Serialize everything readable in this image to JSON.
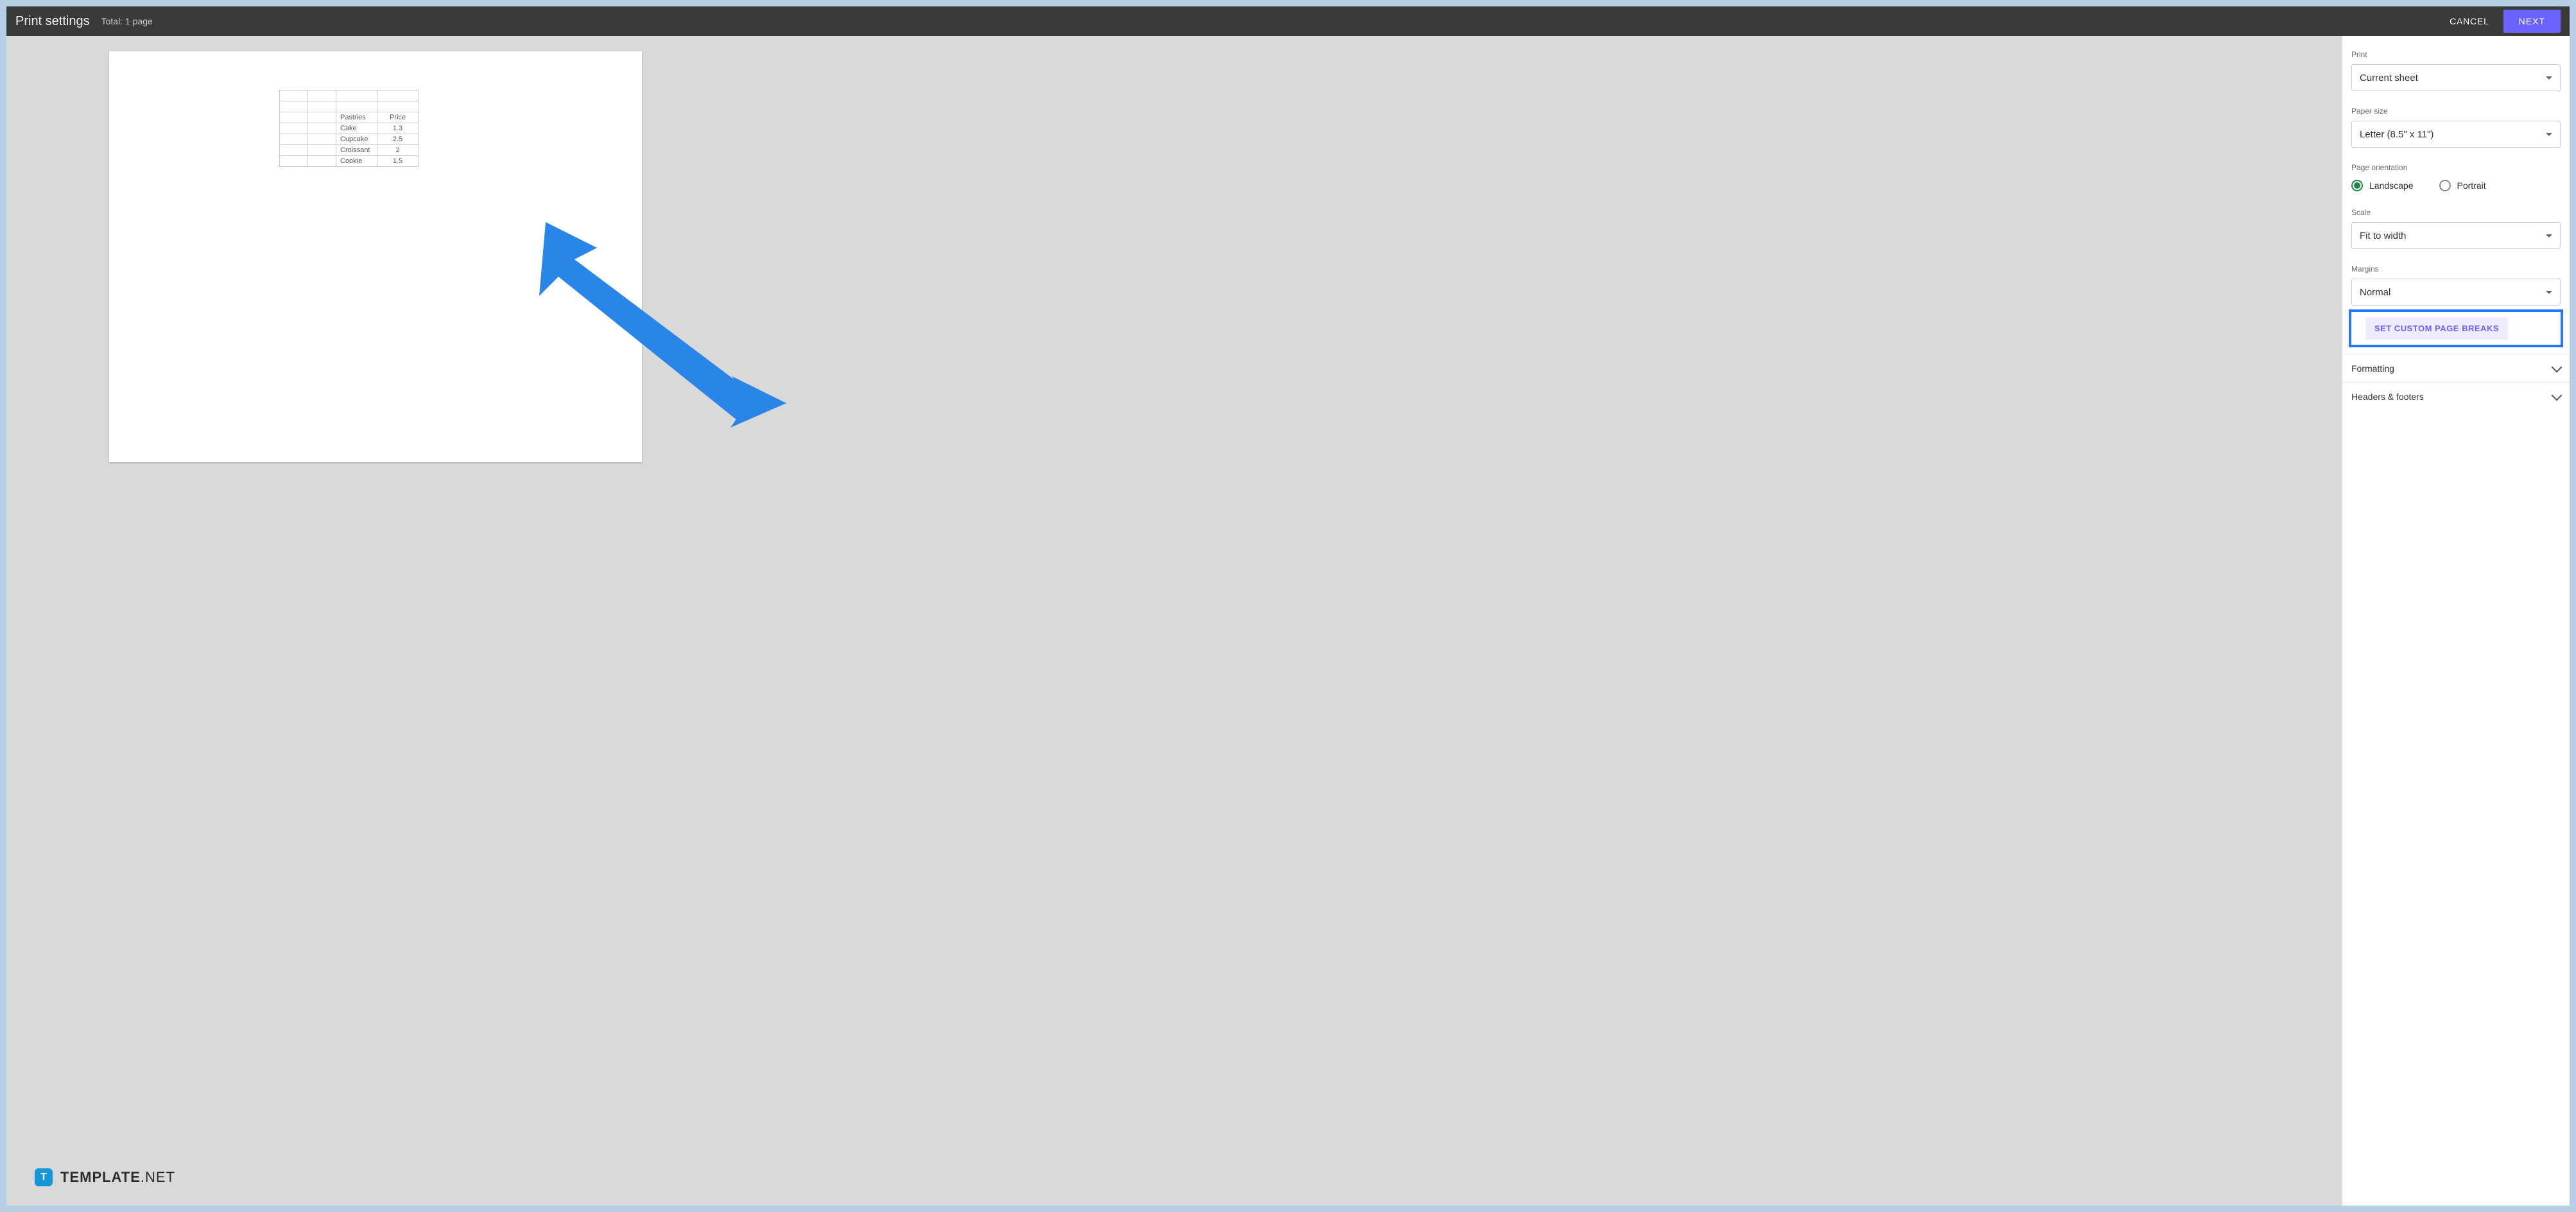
{
  "topbar": {
    "title": "Print settings",
    "total": "Total: 1 page",
    "cancel": "CANCEL",
    "next": "NEXT"
  },
  "preview_table": {
    "headers": {
      "col1": "Pastries",
      "col2": "Price"
    },
    "rows": [
      {
        "name": "Cake",
        "price": "1.3"
      },
      {
        "name": "Cupcake",
        "price": "2.5"
      },
      {
        "name": "Croissant",
        "price": "2"
      },
      {
        "name": "Cookie",
        "price": "1.5"
      }
    ]
  },
  "sidebar": {
    "print": {
      "label": "Print",
      "value": "Current sheet"
    },
    "paper": {
      "label": "Paper size",
      "value": "Letter (8.5\" x 11\")"
    },
    "orientation": {
      "label": "Page orientation",
      "landscape": "Landscape",
      "portrait": "Portrait"
    },
    "scale": {
      "label": "Scale",
      "value": "Fit to width"
    },
    "margins": {
      "label": "Margins",
      "value": "Normal"
    },
    "custom_breaks": "SET CUSTOM PAGE BREAKS",
    "formatting": "Formatting",
    "headers_footers": "Headers & footers"
  },
  "watermark": {
    "badge": "T",
    "bold": "TEMPLATE",
    "rest": ".NET"
  }
}
